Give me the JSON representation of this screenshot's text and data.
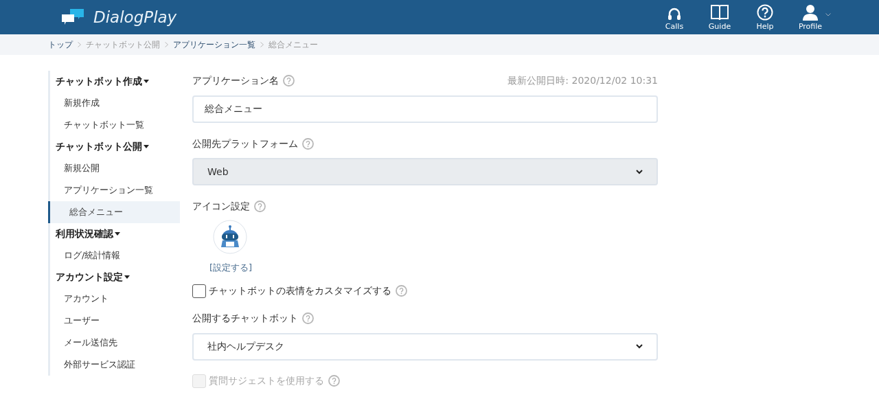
{
  "header": {
    "logo": "DialogPlay",
    "nav": [
      {
        "kind": "calls",
        "label": "Calls"
      },
      {
        "kind": "guide",
        "label": "Guide"
      },
      {
        "kind": "help",
        "label": "Help"
      },
      {
        "kind": "profile",
        "label": "Profile"
      }
    ]
  },
  "breadcrumb": [
    {
      "label": "トップ",
      "link": true
    },
    {
      "label": "チャットボット公開",
      "link": false
    },
    {
      "label": "アプリケーション一覧",
      "link": true
    },
    {
      "label": "総合メニュー",
      "link": false
    }
  ],
  "sidebar": [
    {
      "title": "チャットボット作成",
      "items": [
        {
          "label": "新規作成",
          "selected": false
        },
        {
          "label": "チャットボット一覧",
          "selected": false
        }
      ]
    },
    {
      "title": "チャットボット公開",
      "items": [
        {
          "label": "新規公開",
          "selected": false
        },
        {
          "label": "アプリケーション一覧",
          "selected": false,
          "children": [
            {
              "label": "総合メニュー",
              "selected": true
            }
          ]
        }
      ]
    },
    {
      "title": "利用状況確認",
      "items": [
        {
          "label": "ログ/統計情報",
          "selected": false
        }
      ]
    },
    {
      "title": "アカウント設定",
      "items": [
        {
          "label": "アカウント",
          "selected": false
        },
        {
          "label": "ユーザー",
          "selected": false
        },
        {
          "label": "メール送信先",
          "selected": false
        },
        {
          "label": "外部サービス認証",
          "selected": false
        }
      ]
    }
  ],
  "form": {
    "last_published": "最新公開日時: 2020/12/02 10:31",
    "fields": [
      {
        "kind": "text",
        "label": "アプリケーション名",
        "value": "総合メニュー"
      },
      {
        "kind": "select",
        "label": "公開先プラットフォーム",
        "value": "Web",
        "disabled": true
      },
      {
        "kind": "icon",
        "label": "アイコン設定",
        "link": "[設定する]"
      },
      {
        "kind": "checkbox",
        "label": "チャットボットの表情をカスタマイズする",
        "checked": false,
        "disabled": false
      },
      {
        "kind": "select",
        "label": "公開するチャットボット",
        "value": "社内ヘルプデスク",
        "disabled": false
      },
      {
        "kind": "checkbox",
        "label": "質問サジェストを使用する",
        "checked": false,
        "disabled": true
      }
    ]
  }
}
